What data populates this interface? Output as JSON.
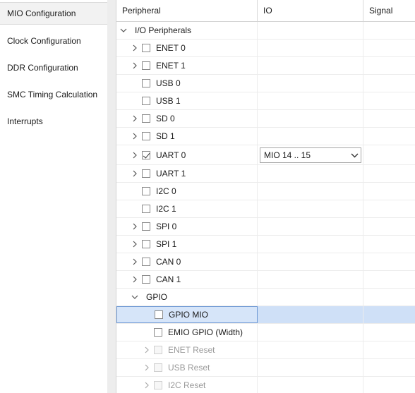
{
  "sidebar": {
    "items": [
      {
        "label": "MIO Configuration",
        "active": true
      },
      {
        "label": "Clock Configuration",
        "active": false
      },
      {
        "label": "DDR Configuration",
        "active": false
      },
      {
        "label": "SMC Timing Calculation",
        "active": false
      },
      {
        "label": "Interrupts",
        "active": false
      }
    ]
  },
  "table": {
    "headers": {
      "peripheral": "Peripheral",
      "io": "IO",
      "signal": "Signal"
    },
    "rows": [
      {
        "label": "I/O Peripherals",
        "expander": "open",
        "checkbox": "none",
        "level": 0
      },
      {
        "label": "ENET 0",
        "expander": "closed",
        "checkbox": "unchecked",
        "level": 1
      },
      {
        "label": "ENET 1",
        "expander": "closed",
        "checkbox": "unchecked",
        "level": 1
      },
      {
        "label": "USB 0",
        "expander": "none",
        "checkbox": "unchecked",
        "level": 1
      },
      {
        "label": "USB 1",
        "expander": "none",
        "checkbox": "unchecked",
        "level": 1
      },
      {
        "label": "SD 0",
        "expander": "closed",
        "checkbox": "unchecked",
        "level": 1
      },
      {
        "label": "SD 1",
        "expander": "closed",
        "checkbox": "unchecked",
        "level": 1
      },
      {
        "label": "UART 0",
        "expander": "closed",
        "checkbox": "checked",
        "level": 1,
        "io": "MIO 14 .. 15"
      },
      {
        "label": "UART 1",
        "expander": "closed",
        "checkbox": "unchecked",
        "level": 1
      },
      {
        "label": "I2C 0",
        "expander": "none",
        "checkbox": "unchecked",
        "level": 1
      },
      {
        "label": "I2C 1",
        "expander": "none",
        "checkbox": "unchecked",
        "level": 1
      },
      {
        "label": "SPI 0",
        "expander": "closed",
        "checkbox": "unchecked",
        "level": 1
      },
      {
        "label": "SPI 1",
        "expander": "closed",
        "checkbox": "unchecked",
        "level": 1
      },
      {
        "label": "CAN 0",
        "expander": "closed",
        "checkbox": "unchecked",
        "level": 1
      },
      {
        "label": "CAN 1",
        "expander": "closed",
        "checkbox": "unchecked",
        "level": 1
      },
      {
        "label": "GPIO",
        "expander": "open",
        "checkbox": "none",
        "level": 1
      },
      {
        "label": "GPIO MIO",
        "expander": "none",
        "checkbox": "unchecked",
        "level": 2,
        "selected": true
      },
      {
        "label": "EMIO GPIO (Width)",
        "expander": "none",
        "checkbox": "unchecked",
        "level": 2
      },
      {
        "label": "ENET Reset",
        "expander": "closed",
        "checkbox": "disabled",
        "level": 2,
        "disabled": true
      },
      {
        "label": "USB Reset",
        "expander": "closed",
        "checkbox": "disabled",
        "level": 2,
        "disabled": true
      },
      {
        "label": "I2C Reset",
        "expander": "closed",
        "checkbox": "disabled",
        "level": 2,
        "disabled": true
      }
    ]
  },
  "colors": {
    "selection": "#cfe0f7",
    "selection_border": "#6d98d4",
    "disabled_text": "#9a9a9a"
  }
}
